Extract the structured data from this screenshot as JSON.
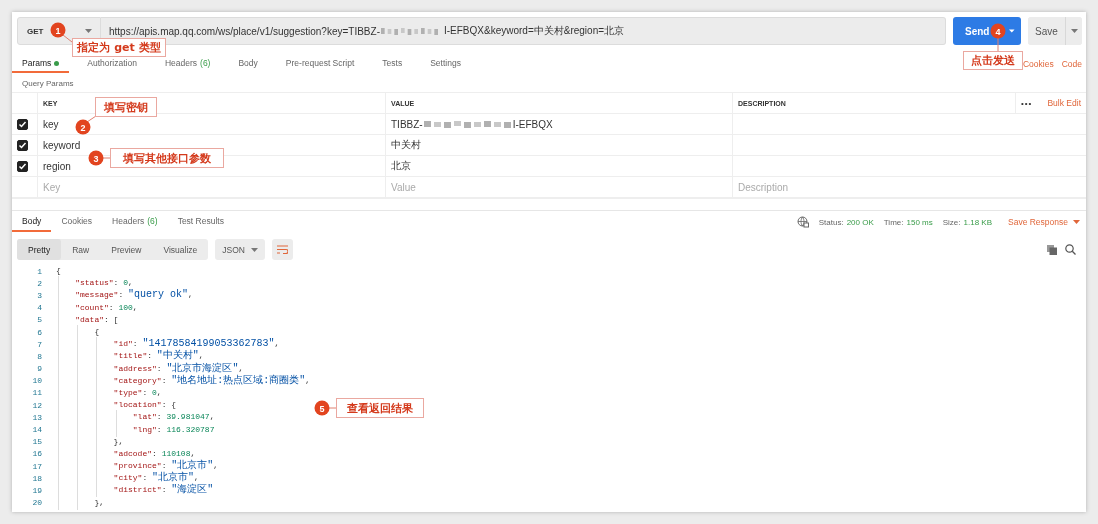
{
  "request": {
    "method": "GET",
    "url_start": "https://apis.map.qq.com/ws/place/v1/suggestion?key=TIBBZ-",
    "url_end": "I-EFBQX&keyword=中关村&region=北京",
    "send": "Send",
    "save": "Save"
  },
  "request_tabs": [
    {
      "label": "Params",
      "selected": true,
      "has_content": true
    },
    {
      "label": "Authorization",
      "selected": false,
      "has_content": false
    },
    {
      "label": "Headers",
      "count": "(6)",
      "selected": false,
      "has_content": false
    },
    {
      "label": "Body",
      "selected": false,
      "has_content": false
    },
    {
      "label": "Pre-request Script",
      "selected": false,
      "has_content": false
    },
    {
      "label": "Tests",
      "selected": false,
      "has_content": false
    },
    {
      "label": "Settings",
      "selected": false,
      "has_content": false
    }
  ],
  "links": [
    "Cookies",
    "Code"
  ],
  "query_params": {
    "title": "Query Params",
    "columns": [
      "KEY",
      "VALUE",
      "DESCRIPTION"
    ],
    "more": "•••",
    "bulk_edit": "Bulk Edit",
    "rows": [
      {
        "checked": true,
        "key": "key",
        "value": "TIBBZ-",
        "value_after_redaction": "I-EFBQX"
      },
      {
        "checked": true,
        "key": "keyword",
        "value": "中关村"
      },
      {
        "checked": true,
        "key": "region",
        "value": "北京"
      }
    ],
    "new_row": [
      {
        "placeholder": "Key"
      },
      {
        "placeholder": "Value"
      },
      {
        "placeholder": "Description"
      }
    ]
  },
  "response": {
    "tabs": [
      {
        "label": "Body",
        "selected": true
      },
      {
        "label": "Cookies",
        "selected": false
      },
      {
        "label": "Headers",
        "count": "(6)",
        "selected": false
      },
      {
        "label": "Test Results",
        "selected": false
      }
    ],
    "status_label": "Status:",
    "status": "200 OK",
    "time_label": "Time:",
    "time": "150 ms",
    "size_label": "Size:",
    "size": "1.18 KB",
    "save_response": "Save Response",
    "views": [
      {
        "label": "Pretty",
        "selected": true
      },
      {
        "label": "Raw",
        "selected": false
      },
      {
        "label": "Preview",
        "selected": false
      },
      {
        "label": "Visualize",
        "selected": false
      }
    ],
    "format": "JSON",
    "lines": [
      {
        "number": "1",
        "tokens": [
          {
            "kind": "punct",
            "text": "{"
          }
        ]
      },
      {
        "number": "2",
        "tokens": [
          {
            "kind": "key",
            "text": "    \"status\""
          },
          {
            "kind": "punct",
            "text": ": "
          },
          {
            "kind": "number",
            "text": "0"
          },
          {
            "kind": "punct",
            "text": ","
          }
        ]
      },
      {
        "number": "3",
        "tokens": [
          {
            "kind": "key",
            "text": "    \"message\""
          },
          {
            "kind": "punct",
            "text": ": "
          },
          {
            "kind": "string",
            "text": "\"query ok\""
          },
          {
            "kind": "punct",
            "text": ","
          }
        ]
      },
      {
        "number": "4",
        "tokens": [
          {
            "kind": "key",
            "text": "    \"count\""
          },
          {
            "kind": "punct",
            "text": ": "
          },
          {
            "kind": "number",
            "text": "100"
          },
          {
            "kind": "punct",
            "text": ","
          }
        ]
      },
      {
        "number": "5",
        "tokens": [
          {
            "kind": "key",
            "text": "    \"data\""
          },
          {
            "kind": "punct",
            "text": ": ["
          }
        ]
      },
      {
        "number": "6",
        "tokens": [
          {
            "kind": "punct",
            "text": "        {"
          }
        ]
      },
      {
        "number": "7",
        "tokens": [
          {
            "kind": "key",
            "text": "            \"id\""
          },
          {
            "kind": "punct",
            "text": ": "
          },
          {
            "kind": "string",
            "text": "\"14178584199053362783\""
          },
          {
            "kind": "punct",
            "text": ","
          }
        ]
      },
      {
        "number": "8",
        "tokens": [
          {
            "kind": "key",
            "text": "            \"title\""
          },
          {
            "kind": "punct",
            "text": ": "
          },
          {
            "kind": "string",
            "text": "\"中关村\""
          },
          {
            "kind": "punct",
            "text": ","
          }
        ]
      },
      {
        "number": "9",
        "tokens": [
          {
            "kind": "key",
            "text": "            \"address\""
          },
          {
            "kind": "punct",
            "text": ": "
          },
          {
            "kind": "string",
            "text": "\"北京市海淀区\""
          },
          {
            "kind": "punct",
            "text": ","
          }
        ]
      },
      {
        "number": "10",
        "tokens": [
          {
            "kind": "key",
            "text": "            \"category\""
          },
          {
            "kind": "punct",
            "text": ": "
          },
          {
            "kind": "string",
            "text": "\"地名地址:热点区域:商圈类\""
          },
          {
            "kind": "punct",
            "text": ","
          }
        ]
      },
      {
        "number": "11",
        "tokens": [
          {
            "kind": "key",
            "text": "            \"type\""
          },
          {
            "kind": "punct",
            "text": ": "
          },
          {
            "kind": "number",
            "text": "0"
          },
          {
            "kind": "punct",
            "text": ","
          }
        ]
      },
      {
        "number": "12",
        "tokens": [
          {
            "kind": "key",
            "text": "            \"location\""
          },
          {
            "kind": "punct",
            "text": ": {"
          }
        ]
      },
      {
        "number": "13",
        "tokens": [
          {
            "kind": "key",
            "text": "                \"lat\""
          },
          {
            "kind": "punct",
            "text": ": "
          },
          {
            "kind": "number",
            "text": "39.981047"
          },
          {
            "kind": "punct",
            "text": ","
          }
        ]
      },
      {
        "number": "14",
        "tokens": [
          {
            "kind": "key",
            "text": "                \"lng\""
          },
          {
            "kind": "punct",
            "text": ": "
          },
          {
            "kind": "number",
            "text": "116.320787"
          }
        ]
      },
      {
        "number": "15",
        "tokens": [
          {
            "kind": "punct",
            "text": "            },"
          }
        ]
      },
      {
        "number": "16",
        "tokens": [
          {
            "kind": "key",
            "text": "            \"adcode\""
          },
          {
            "kind": "punct",
            "text": ": "
          },
          {
            "kind": "number",
            "text": "110108"
          },
          {
            "kind": "punct",
            "text": ","
          }
        ]
      },
      {
        "number": "17",
        "tokens": [
          {
            "kind": "key",
            "text": "            \"province\""
          },
          {
            "kind": "punct",
            "text": ": "
          },
          {
            "kind": "string",
            "text": "\"北京市\""
          },
          {
            "kind": "punct",
            "text": ","
          }
        ]
      },
      {
        "number": "18",
        "tokens": [
          {
            "kind": "key",
            "text": "            \"city\""
          },
          {
            "kind": "punct",
            "text": ": "
          },
          {
            "kind": "string",
            "text": "\"北京市\""
          },
          {
            "kind": "punct",
            "text": ","
          }
        ]
      },
      {
        "number": "19",
        "tokens": [
          {
            "kind": "key",
            "text": "            \"district\""
          },
          {
            "kind": "punct",
            "text": ": "
          },
          {
            "kind": "string",
            "text": "\"海淀区\""
          }
        ]
      },
      {
        "number": "20",
        "tokens": [
          {
            "kind": "punct",
            "text": "        },"
          }
        ]
      }
    ]
  },
  "annotations": [
    {
      "number": "1",
      "text": "指定为 get 类型"
    },
    {
      "number": "2",
      "text": "填写密钥"
    },
    {
      "number": "3",
      "text": "填写其他接口参数"
    },
    {
      "number": "4",
      "text": "点击发送"
    },
    {
      "number": "5",
      "text": "查看返回结果"
    }
  ]
}
